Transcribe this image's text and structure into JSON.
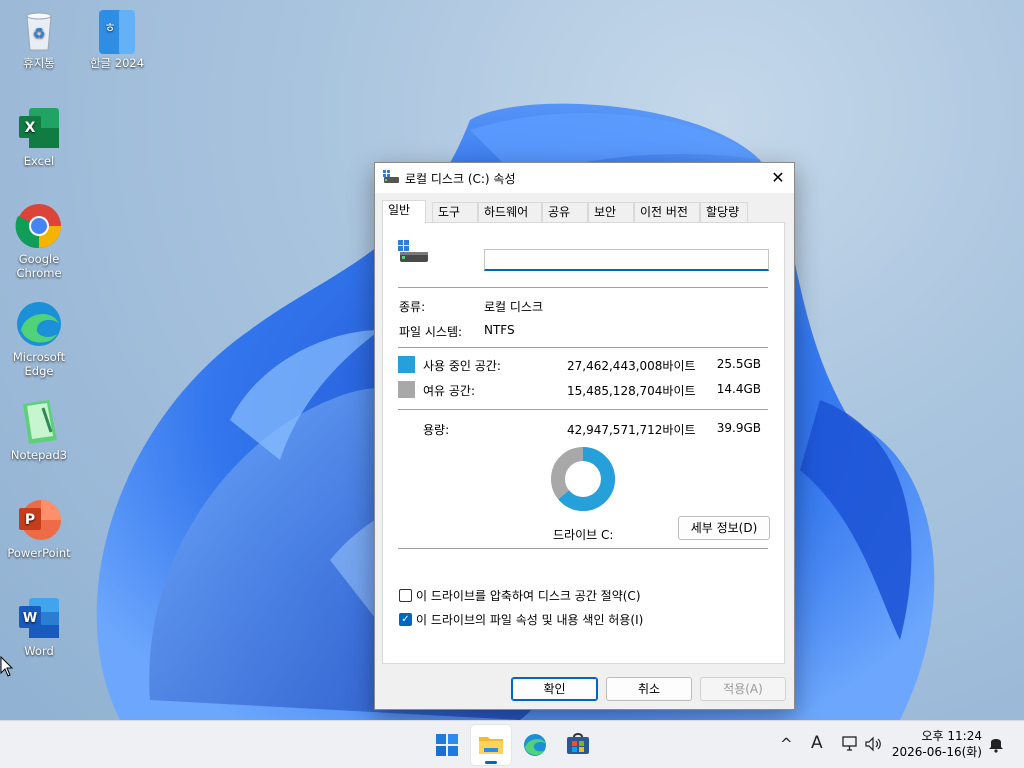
{
  "desktop": {
    "icons": [
      {
        "label": "휴지통"
      },
      {
        "label": "한글 2024"
      },
      {
        "label": "Excel"
      },
      {
        "label": "Google\nChrome"
      },
      {
        "label": "Microsoft\nEdge"
      },
      {
        "label": "Notepad3"
      },
      {
        "label": "PowerPoint"
      },
      {
        "label": "Word"
      }
    ]
  },
  "dialog": {
    "title": "로컬 디스크 (C:) 속성",
    "close_glyph": "✕",
    "tabs": [
      {
        "label": "일반"
      },
      {
        "label": "도구"
      },
      {
        "label": "하드웨어"
      },
      {
        "label": "공유"
      },
      {
        "label": "보안"
      },
      {
        "label": "이전 버전"
      },
      {
        "label": "할당량"
      }
    ],
    "name_value": "",
    "type_label": "종류:",
    "type_value": "로컬 디스크",
    "fs_label": "파일 시스템:",
    "fs_value": "NTFS",
    "used_label": "사용 중인 공간:",
    "used_bytes": "27,462,443,008바이트",
    "used_size": "25.5GB",
    "free_label": "여유 공간:",
    "free_bytes": "15,485,128,704바이트",
    "free_size": "14.4GB",
    "capacity_label": "용량:",
    "capacity_bytes": "42,947,571,712바이트",
    "capacity_size": "39.9GB",
    "drive_label": "드라이브 C:",
    "details_button": "세부 정보(D)",
    "compress_label": "이 드라이브를 압축하여 디스크 공간 절약(C)",
    "compress_checked": false,
    "index_label": "이 드라이브의 파일 속성 및 내용 색인 허용(I)",
    "index_checked": true,
    "ok_button": "확인",
    "cancel_button": "취소",
    "apply_button": "적용(A)",
    "colors": {
      "used": "#26a0da",
      "free": "#a8a8a8",
      "accent": "#0067c0"
    },
    "used_fraction": 0.6394
  },
  "taskbar": {
    "apps": [
      {
        "icon": "windows-start-icon"
      },
      {
        "icon": "file-explorer-icon"
      },
      {
        "icon": "edge-icon"
      },
      {
        "icon": "microsoft-store-icon"
      }
    ],
    "tray_chevron": "^",
    "ime_indicator": "A",
    "time": "오후 11:24",
    "date": "2026-06-16(화)"
  }
}
